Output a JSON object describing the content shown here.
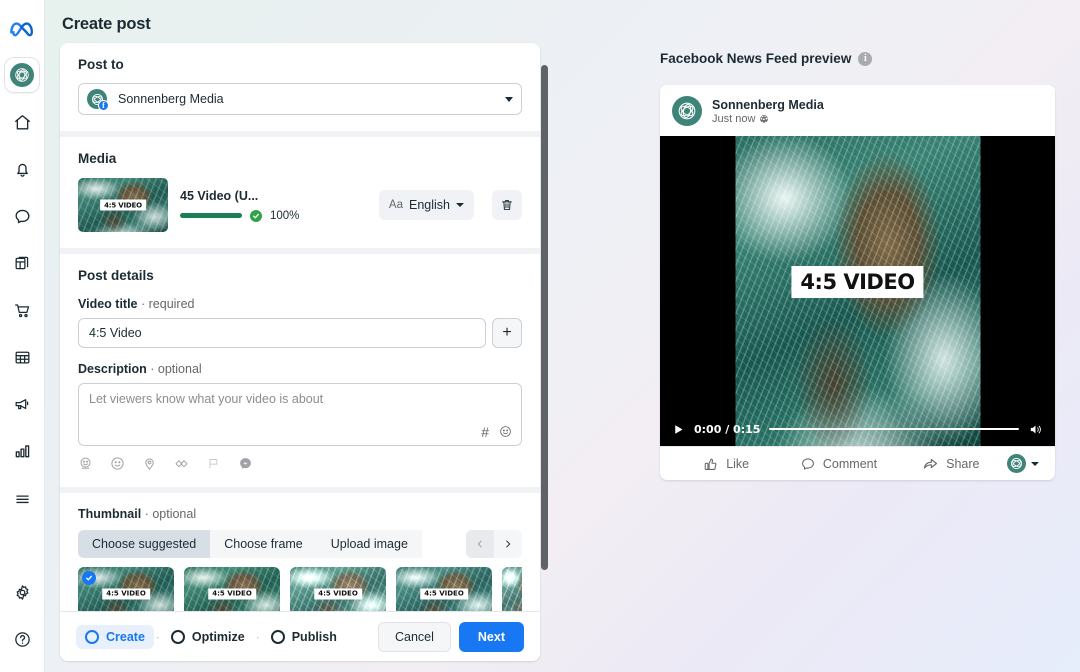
{
  "page_title": "Create post",
  "rail": {
    "items": [
      {
        "name": "meta-logo",
        "label": "Meta"
      },
      {
        "name": "brand-avatar",
        "label": "Sonnenberg Media"
      },
      {
        "name": "home",
        "label": "Home"
      },
      {
        "name": "notifications",
        "label": "Notifications"
      },
      {
        "name": "messages",
        "label": "Messages"
      },
      {
        "name": "pages",
        "label": "Pages"
      },
      {
        "name": "commerce",
        "label": "Commerce"
      },
      {
        "name": "planner",
        "label": "Planner"
      },
      {
        "name": "ads",
        "label": "Ads"
      },
      {
        "name": "insights",
        "label": "Insights"
      },
      {
        "name": "all-tools",
        "label": "All tools"
      }
    ],
    "bottom": [
      {
        "name": "settings",
        "label": "Settings"
      },
      {
        "name": "help",
        "label": "Help"
      }
    ]
  },
  "post_to": {
    "section_title": "Post to",
    "selected": "Sonnenberg Media",
    "badge": "f"
  },
  "media": {
    "section_title": "Media",
    "file_name": "45 Video (U...",
    "progress_pct": "100%",
    "progress_value": 100,
    "language_prefix": "Aa",
    "language": "English",
    "thumb_overlay": "4:5 VIDEO"
  },
  "post_details": {
    "section_title": "Post details",
    "video_title_label": "Video title",
    "video_title_req": "· required",
    "video_title_value": "4:5 Video",
    "add_button": "+",
    "description_label": "Description",
    "description_opt": "· optional",
    "description_placeholder": "Let viewers know what your video is about",
    "description_value": "",
    "tool_hash": "#",
    "tool_emoji": "☺",
    "attachment_icons": [
      "feeling-activity-icon",
      "emoji-icon",
      "location-icon",
      "tag-people-icon",
      "flag-icon",
      "message-icon"
    ]
  },
  "thumbnail": {
    "section_title": "Thumbnail",
    "section_opt": "· optional",
    "tabs": [
      {
        "label": "Choose suggested",
        "active": true
      },
      {
        "label": "Choose frame",
        "active": false
      },
      {
        "label": "Upload image",
        "active": false
      }
    ],
    "prev_label": "‹",
    "next_label": "›",
    "cards": [
      {
        "overlay": "4:5 VIDEO",
        "selected": true
      },
      {
        "overlay": "4:5 VIDEO",
        "selected": false
      },
      {
        "overlay": "4:5 VIDEO",
        "selected": false
      },
      {
        "overlay": "4:5 VIDEO",
        "selected": false
      },
      {
        "overlay": "",
        "selected": false
      }
    ]
  },
  "footer": {
    "steps": [
      {
        "label": "Create",
        "active": true
      },
      {
        "label": "Optimize",
        "active": false
      },
      {
        "label": "Publish",
        "active": false
      }
    ],
    "cancel_label": "Cancel",
    "next_label": "Next"
  },
  "preview": {
    "title": "Facebook News Feed preview",
    "info": "i",
    "page_name": "Sonnenberg Media",
    "timestamp": "Just now",
    "video_overlay": "4:5 VIDEO",
    "time_display": "0:00 / 0:15",
    "actions": [
      {
        "label": "Like",
        "icon": "thumbs-up-icon"
      },
      {
        "label": "Comment",
        "icon": "comment-icon"
      },
      {
        "label": "Share",
        "icon": "share-icon"
      }
    ]
  },
  "colors": {
    "brand_teal": "#3f8478",
    "fb_blue": "#1877f2",
    "success_green": "#31a24c",
    "progress_green": "#1a7f56"
  }
}
